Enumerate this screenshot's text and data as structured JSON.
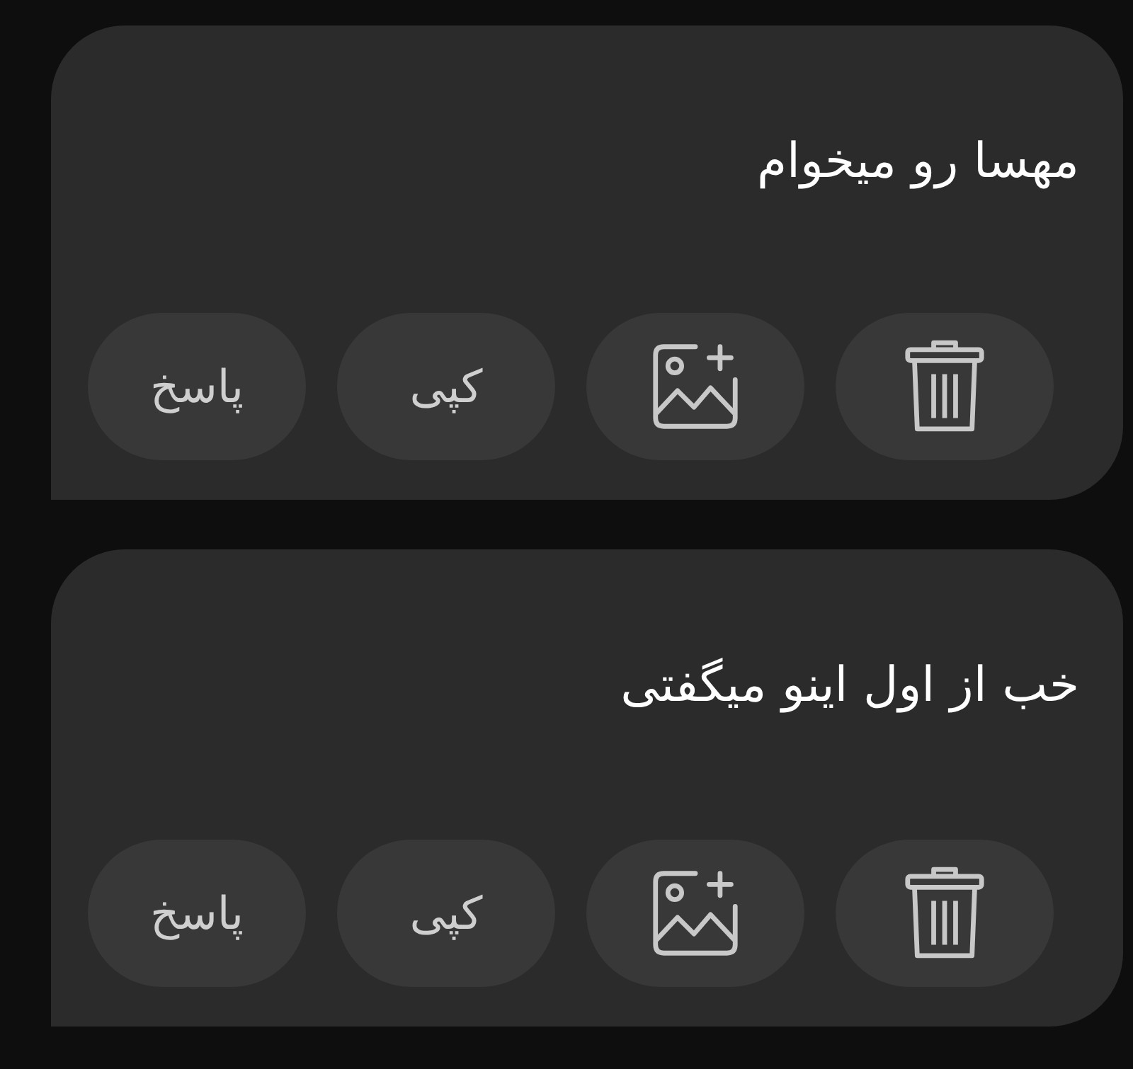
{
  "messages": [
    {
      "text": "مهسا رو میخوام",
      "actions": [
        {
          "kind": "delete"
        },
        {
          "kind": "add-image"
        },
        {
          "kind": "text",
          "label": "کپی"
        },
        {
          "kind": "text",
          "label": "پاسخ"
        }
      ]
    },
    {
      "text": "خب از اول اینو میگفتی",
      "actions": [
        {
          "kind": "delete"
        },
        {
          "kind": "add-image"
        },
        {
          "kind": "text",
          "label": "کپی"
        },
        {
          "kind": "text",
          "label": "پاسخ"
        }
      ]
    }
  ]
}
